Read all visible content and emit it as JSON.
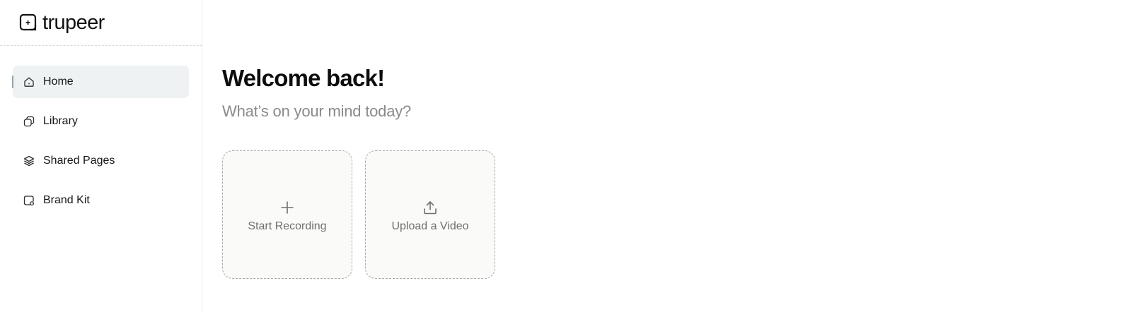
{
  "brand": {
    "name": "trupeer",
    "icon": "trupeer-logo-icon"
  },
  "sidebar": {
    "items": [
      {
        "label": "Home",
        "icon": "home-icon",
        "active": true
      },
      {
        "label": "Library",
        "icon": "library-icon",
        "active": false
      },
      {
        "label": "Shared Pages",
        "icon": "layers-icon",
        "active": false
      },
      {
        "label": "Brand Kit",
        "icon": "brand-kit-icon",
        "active": false
      }
    ]
  },
  "main": {
    "title": "Welcome back!",
    "subtitle": "What’s on your mind today?",
    "actions": [
      {
        "label": "Start Recording",
        "icon": "plus-icon"
      },
      {
        "label": "Upload a Video",
        "icon": "upload-icon"
      }
    ]
  },
  "colors": {
    "active_nav_bg": "#eef2f2",
    "card_border": "#a9a9a9",
    "subtitle": "#8a8a8a"
  }
}
